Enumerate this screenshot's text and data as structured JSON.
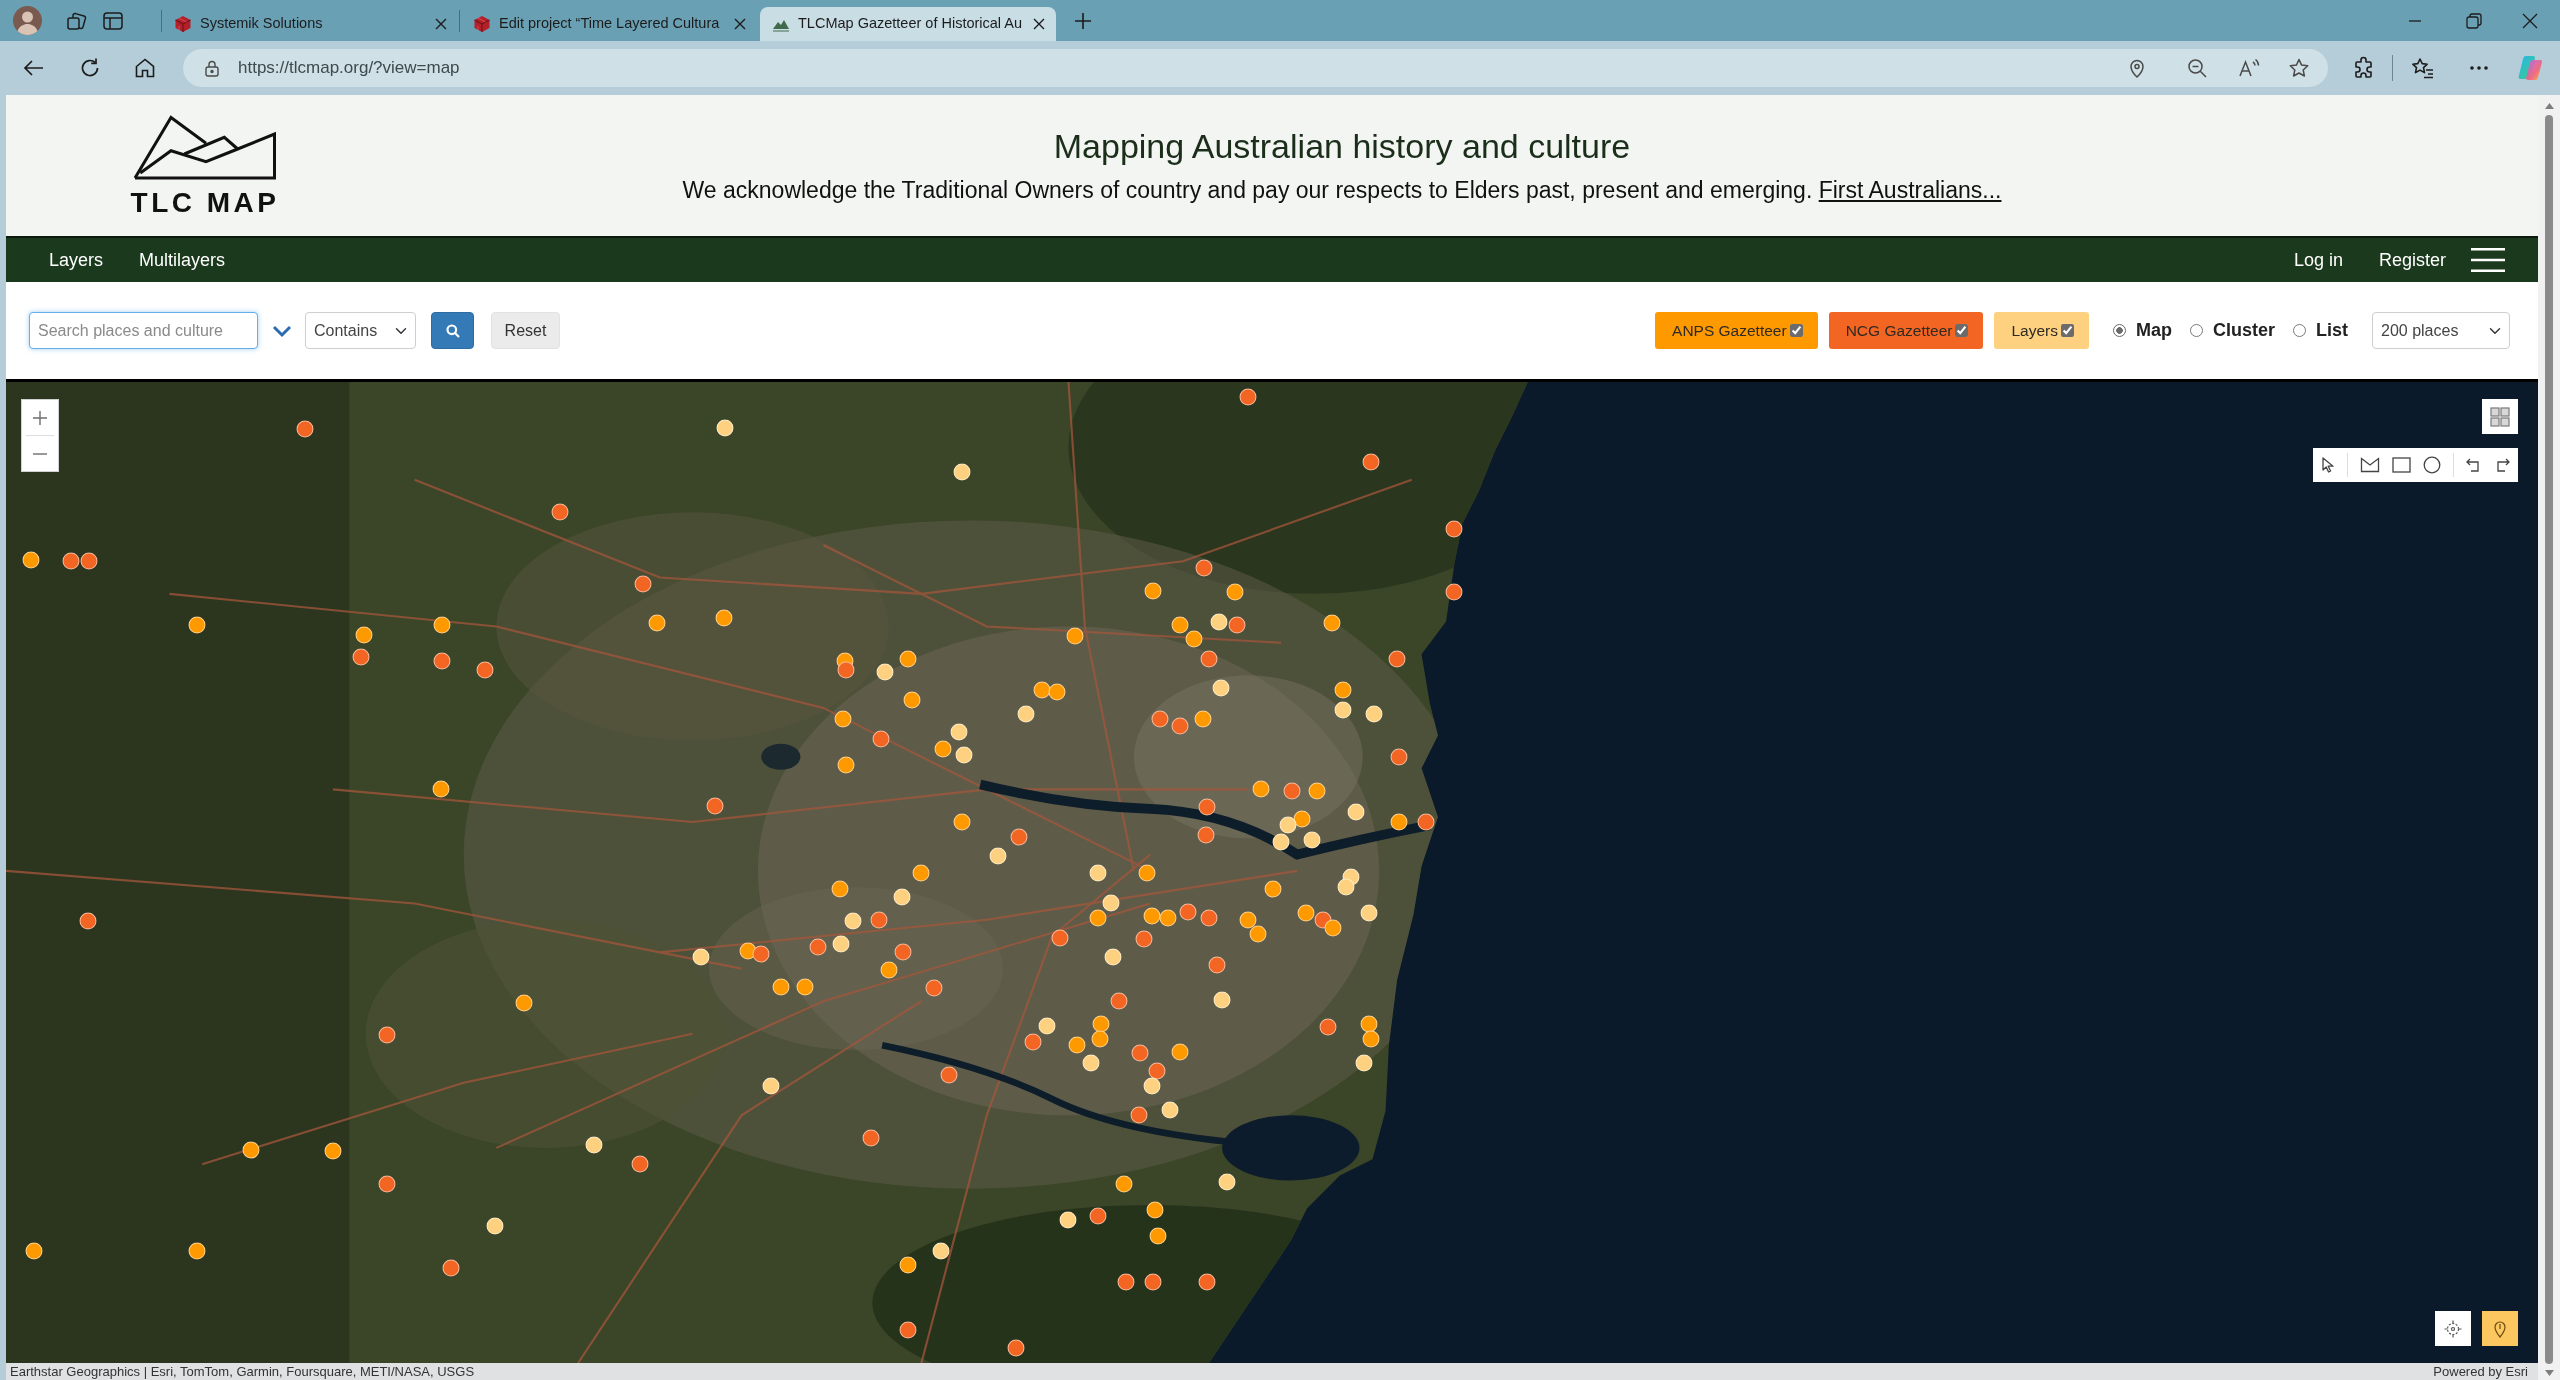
{
  "browser": {
    "tabs": [
      {
        "title": "Systemik Solutions",
        "selected": false
      },
      {
        "title": "Edit project “Time Layered Cultura",
        "selected": false
      },
      {
        "title": "TLCMap Gazetteer of Historical Au",
        "selected": true
      }
    ],
    "address": "https://tlcmap.org/?view=map"
  },
  "header": {
    "logo_text": "TLC MAP",
    "title": "Mapping Australian history and culture",
    "acknowledgement": "We acknowledge the Traditional Owners of country and pay our respects to Elders past, present and emerging.",
    "link": "First Australians..."
  },
  "navbar": {
    "left_items": [
      "Layers",
      "Multilayers"
    ],
    "right_items": [
      "Log in",
      "Register"
    ]
  },
  "search": {
    "placeholder": "Search places and culture",
    "match": "Contains",
    "reset": "Reset",
    "sources": [
      {
        "label": "ANPS Gazetteer",
        "checked": true,
        "color": "#ff9900"
      },
      {
        "label": "NCG Gazetteer",
        "checked": true,
        "color": "#f26522"
      },
      {
        "label": "Layers",
        "checked": true,
        "color": "#fdd17f"
      }
    ],
    "views": [
      {
        "label": "Map",
        "selected": true
      },
      {
        "label": "Cluster",
        "selected": false
      },
      {
        "label": "List",
        "selected": false
      }
    ],
    "limit": "200 places"
  },
  "map": {
    "markers": [
      {
        "color": "#f26522"
      },
      {
        "color": "#f26522"
      },
      {
        "color": "#fdd17f"
      },
      {
        "color": "#f26522"
      },
      {
        "color": "#fdd17f"
      },
      {
        "color": "#f26522"
      },
      {
        "color": "#f26522"
      },
      {
        "color": "#ff9900"
      },
      {
        "color": "#f26522"
      },
      {
        "color": "#f26522"
      },
      {
        "color": "#f26522"
      },
      {
        "color": "#f26522"
      },
      {
        "color": "#ff9900"
      },
      {
        "color": "#ff9900"
      },
      {
        "color": "#f26522"
      },
      {
        "color": "#ff9900"
      },
      {
        "color": "#ff9900"
      },
      {
        "color": "#ff9900"
      },
      {
        "color": "#ff9900"
      },
      {
        "color": "#ff9900"
      },
      {
        "color": "#ff9900"
      },
      {
        "color": "#fdd17f"
      },
      {
        "color": "#f26522"
      },
      {
        "color": "#ff9900"
      },
      {
        "color": "#ff9900"
      },
      {
        "color": "#ff9900"
      },
      {
        "color": "#f26522"
      },
      {
        "color": "#f26522"
      },
      {
        "color": "#f26522"
      },
      {
        "color": "#ff9900"
      },
      {
        "color": "#f26522"
      },
      {
        "color": "#ff9900"
      },
      {
        "color": "#fdd17f"
      },
      {
        "color": "#f26522"
      },
      {
        "color": "#fdd17f"
      },
      {
        "color": "#f26522"
      },
      {
        "color": "#ff9900"
      },
      {
        "color": "#ff9900"
      },
      {
        "color": "#ff9900"
      },
      {
        "color": "#ff9900"
      },
      {
        "color": "#fdd17f"
      },
      {
        "color": "#ff9900"
      },
      {
        "color": "#fdd17f"
      },
      {
        "color": "#ff9900"
      },
      {
        "color": "#fdd17f"
      },
      {
        "color": "#f26522"
      },
      {
        "color": "#f26522"
      },
      {
        "color": "#f26522"
      },
      {
        "color": "#ff9900"
      },
      {
        "color": "#fdd17f"
      },
      {
        "color": "#fdd17f"
      },
      {
        "color": "#ff9900"
      },
      {
        "color": "#f26522"
      },
      {
        "color": "#ff9900"
      },
      {
        "color": "#ff9900"
      },
      {
        "color": "#ff9900"
      },
      {
        "color": "#f26522"
      },
      {
        "color": "#f26522"
      },
      {
        "color": "#fdd17f"
      },
      {
        "color": "#ff9900"
      },
      {
        "color": "#f26522"
      },
      {
        "color": "#ff9900"
      },
      {
        "color": "#f26522"
      },
      {
        "color": "#fdd17f"
      },
      {
        "color": "#ff9900"
      },
      {
        "color": "#f26522"
      },
      {
        "color": "#f26522"
      },
      {
        "color": "#fdd17f"
      },
      {
        "color": "#fdd17f"
      },
      {
        "color": "#fdd17f"
      },
      {
        "color": "#ff9900"
      },
      {
        "color": "#fdd17f"
      },
      {
        "color": "#fdd17f"
      },
      {
        "color": "#ff9900"
      },
      {
        "color": "#fdd17f"
      },
      {
        "color": "#ff9900"
      },
      {
        "color": "#fdd17f"
      },
      {
        "color": "#ff9900"
      },
      {
        "color": "#fdd17f"
      },
      {
        "color": "#fdd17f"
      },
      {
        "color": "#ff9900"
      },
      {
        "color": "#ff9900"
      },
      {
        "color": "#f26522"
      },
      {
        "color": "#ff9900"
      },
      {
        "color": "#f26522"
      },
      {
        "color": "#ff9900"
      },
      {
        "color": "#ff9900"
      },
      {
        "color": "#f26522"
      },
      {
        "color": "#f26522"
      },
      {
        "color": "#fdd17f"
      },
      {
        "color": "#f26522"
      },
      {
        "color": "#ff9900"
      },
      {
        "color": "#f26522"
      },
      {
        "color": "#f26522"
      },
      {
        "color": "#fdd17f"
      },
      {
        "color": "#f26522"
      },
      {
        "color": "#fdd17f"
      },
      {
        "color": "#ff9900"
      },
      {
        "color": "#ff9900"
      },
      {
        "color": "#f26522"
      },
      {
        "color": "#fdd17f"
      },
      {
        "color": "#f26522"
      },
      {
        "color": "#ff9900"
      },
      {
        "color": "#ff9900"
      },
      {
        "color": "#ff9900"
      },
      {
        "color": "#f26522"
      },
      {
        "color": "#f26522"
      },
      {
        "color": "#fdd17f"
      },
      {
        "color": "#fdd17f"
      },
      {
        "color": "#ff9900"
      },
      {
        "color": "#f26522"
      },
      {
        "color": "#ff9900"
      },
      {
        "color": "#f26522"
      },
      {
        "color": "#ff9900"
      },
      {
        "color": "#ff9900"
      },
      {
        "color": "#ff9900"
      },
      {
        "color": "#f26522"
      },
      {
        "color": "#ff9900"
      },
      {
        "color": "#f26522"
      },
      {
        "color": "#fdd17f"
      },
      {
        "color": "#fdd17f"
      },
      {
        "color": "#f26522"
      },
      {
        "color": "#fdd17f"
      },
      {
        "color": "#fdd17f"
      },
      {
        "color": "#fdd17f"
      },
      {
        "color": "#f26522"
      },
      {
        "color": "#f26522"
      },
      {
        "color": "#fdd17f"
      },
      {
        "color": "#ff9900"
      },
      {
        "color": "#ff9900"
      },
      {
        "color": "#f26522"
      },
      {
        "color": "#f26522"
      },
      {
        "color": "#fdd17f"
      },
      {
        "color": "#ff9900"
      },
      {
        "color": "#f26522"
      },
      {
        "color": "#fdd17f"
      },
      {
        "color": "#ff9900"
      },
      {
        "color": "#ff9900"
      },
      {
        "color": "#ff9900"
      },
      {
        "color": "#ff9900"
      },
      {
        "color": "#fdd17f"
      },
      {
        "color": "#ff9900"
      },
      {
        "color": "#f26522"
      },
      {
        "color": "#f26522"
      },
      {
        "color": "#f26522"
      },
      {
        "color": "#f26522"
      },
      {
        "color": "#f26522"
      },
      {
        "color": "#f26522"
      },
      {
        "color": "#fdd17f"
      },
      {
        "color": "#ff9900"
      },
      {
        "color": "#f26522"
      },
      {
        "color": "#f26522"
      }
    ],
    "attribution": "Earthstar Geographics | Esri, TomTom, Garmin, Foursquare, METI/NASA, USGS",
    "powered_by": "Powered by Esri"
  }
}
